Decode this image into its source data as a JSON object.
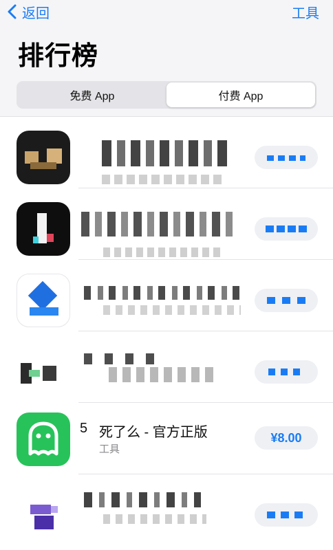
{
  "nav": {
    "back_label": "返回",
    "right_label": "工具"
  },
  "page": {
    "title": "排行榜"
  },
  "segments": [
    {
      "label": "免费 App",
      "selected": false
    },
    {
      "label": "付费 App",
      "selected": true
    }
  ],
  "featured_app": {
    "rank": "5",
    "name": "死了么 - 官方正版",
    "category": "工具",
    "price": "¥8.00",
    "icon": "ghost-icon",
    "icon_color": "#27c35a"
  },
  "colors": {
    "accent": "#1a7cf5",
    "background": "#ffffff",
    "header_bg": "#f5f5f7"
  }
}
